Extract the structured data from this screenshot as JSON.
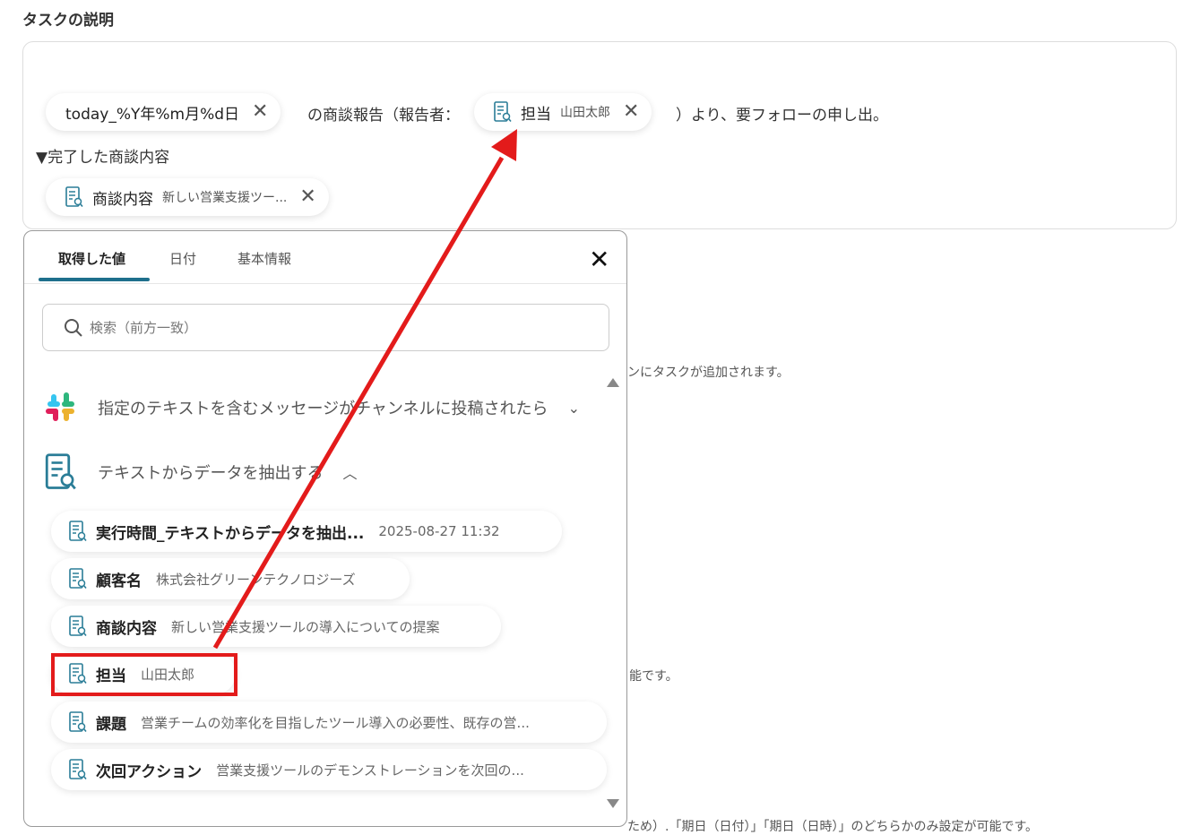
{
  "section_title": "タスクの説明",
  "editor": {
    "date_token": "today_%Y年%m月%d日",
    "text1": "の商談報告（報告者：",
    "assignee_token": {
      "label": "担当",
      "value": "山田太郎"
    },
    "text2": "）より、要フォローの申し出。",
    "heading": "▼完了した商談内容",
    "content_token": {
      "label": "商談内容",
      "value": "新しい営業支援ツー..."
    }
  },
  "background_texts": [
    "ンにタスクが追加されます。",
    "能です。",
    "ため）.「期日（日付）」「期日（日時）」のどちらかのみ設定が可能です。"
  ],
  "popup": {
    "tabs": [
      "取得した値",
      "日付",
      "基本情報"
    ],
    "search_placeholder": "検索（前方一致）",
    "groups": [
      {
        "title": "指定のテキストを含むメッセージがチャンネルに投稿されたら",
        "icon": "slack-icon",
        "expanded": false
      },
      {
        "title": "テキストからデータを抽出する",
        "icon": "document-search-icon",
        "expanded": true
      }
    ],
    "items": [
      {
        "label": "実行時間_テキストからデータを抽出...",
        "value": "2025-08-27 11:32"
      },
      {
        "label": "顧客名",
        "value": "株式会社グリーンテクノロジーズ"
      },
      {
        "label": "商談内容",
        "value": "新しい営業支援ツールの導入についての提案"
      },
      {
        "label": "担当",
        "value": "山田太郎"
      },
      {
        "label": "課題",
        "value": "営業チームの効率化を目指したツール導入の必要性、既存の営..."
      },
      {
        "label": "次回アクション",
        "value": "営業支援ツールのデモンストレーションを次回の..."
      }
    ]
  },
  "colors": {
    "accent": "#1e6f8c",
    "annotation": "#e31b1b"
  }
}
